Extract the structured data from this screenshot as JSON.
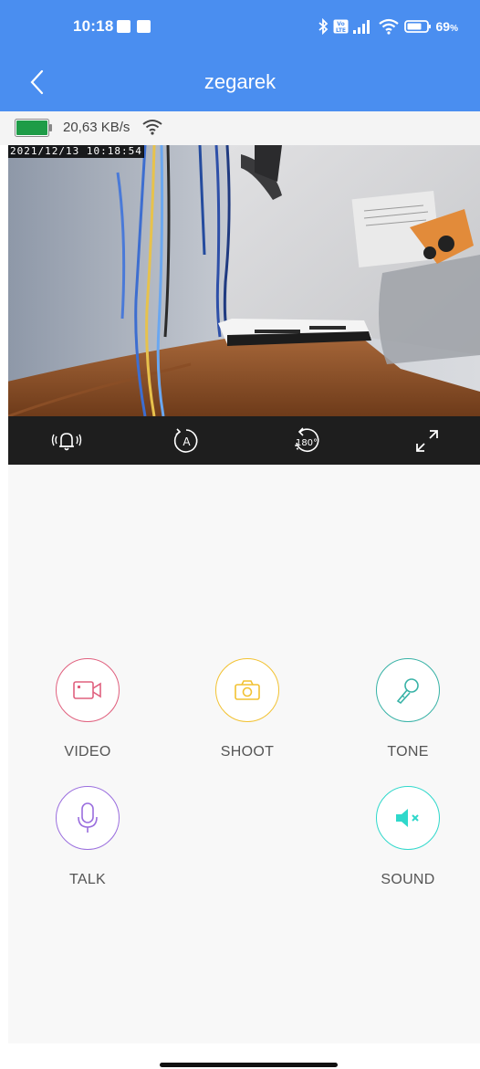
{
  "status_bar": {
    "time": "10:18",
    "battery_percent": "69",
    "battery_suffix": "%",
    "icons": [
      "notification-square-icon",
      "notification-square-icon",
      "bluetooth-icon",
      "volte-icon",
      "signal-icon",
      "wifi-icon",
      "battery-icon"
    ]
  },
  "app_bar": {
    "title": "zegarek",
    "back_icon": "chevron-left-icon"
  },
  "stream_info": {
    "device_battery_level": 1.0,
    "speed": "20,63 KB/s",
    "wifi_icon": "wifi-icon"
  },
  "video": {
    "timestamp": "2021/12/13 10:18:54"
  },
  "player_controls": [
    {
      "icon": "alarm-bell-icon"
    },
    {
      "icon": "auto-rotate-icon"
    },
    {
      "icon": "rotate-180-icon",
      "text": "180°"
    },
    {
      "icon": "fullscreen-icon"
    }
  ],
  "actions": [
    {
      "label": "VIDEO",
      "icon": "video-record-icon",
      "color": "#e0607e"
    },
    {
      "label": "SHOOT",
      "icon": "camera-icon",
      "color": "#f2c232"
    },
    {
      "label": "TONE",
      "icon": "microphone-karaoke-icon",
      "color": "#37b2a6"
    },
    {
      "label": "TALK",
      "icon": "microphone-icon",
      "color": "#9a6ede"
    },
    {
      "label": "SOUND",
      "icon": "speaker-mute-icon",
      "color": "#2fd8cb"
    }
  ],
  "colors": {
    "header": "#4a8ef0",
    "battery_green": "#1e9c47",
    "control_bar": "#1e1e1e",
    "content_bg": "#f8f8f8"
  }
}
